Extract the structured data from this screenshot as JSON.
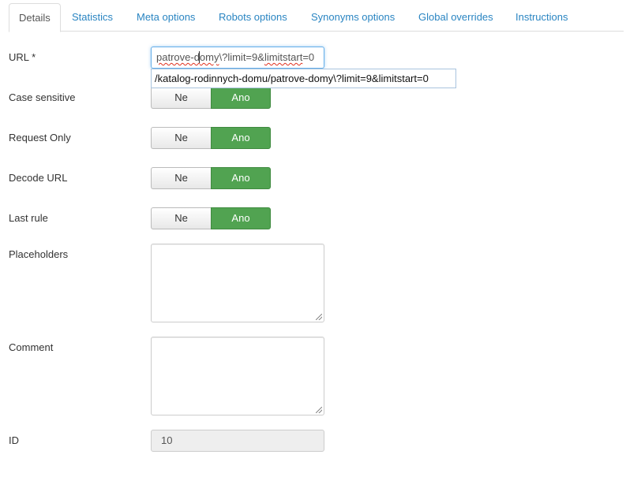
{
  "tabs": [
    {
      "label": "Details",
      "active": true
    },
    {
      "label": "Statistics",
      "active": false
    },
    {
      "label": "Meta options",
      "active": false
    },
    {
      "label": "Robots options",
      "active": false
    },
    {
      "label": "Synonyms options",
      "active": false
    },
    {
      "label": "Global overrides",
      "active": false
    },
    {
      "label": "Instructions",
      "active": false
    }
  ],
  "form": {
    "url": {
      "label": "URL *",
      "value_part1": "patrove-d",
      "value_part2": "omy",
      "value_part3": "\\?limit=9&",
      "value_part4": "limitstart",
      "value_part5": "=0",
      "autocomplete": "/katalog-rodinnych-domu/patrove-domy\\?limit=9&limitstart=0"
    },
    "case_sensitive": {
      "label": "Case sensitive",
      "off": "Ne",
      "on": "Ano",
      "selected": "Ano"
    },
    "request_only": {
      "label": "Request Only",
      "off": "Ne",
      "on": "Ano",
      "selected": "Ano"
    },
    "decode_url": {
      "label": "Decode URL",
      "off": "Ne",
      "on": "Ano",
      "selected": "Ano"
    },
    "last_rule": {
      "label": "Last rule",
      "off": "Ne",
      "on": "Ano",
      "selected": "Ano"
    },
    "placeholders": {
      "label": "Placeholders",
      "value": ""
    },
    "comment": {
      "label": "Comment",
      "value": ""
    },
    "id": {
      "label": "ID",
      "value": "10"
    }
  },
  "colors": {
    "accent_link": "#2a85c2",
    "toggle_on": "#51a351",
    "focus_border": "#66afe9",
    "readonly_bg": "#eeeeee"
  }
}
